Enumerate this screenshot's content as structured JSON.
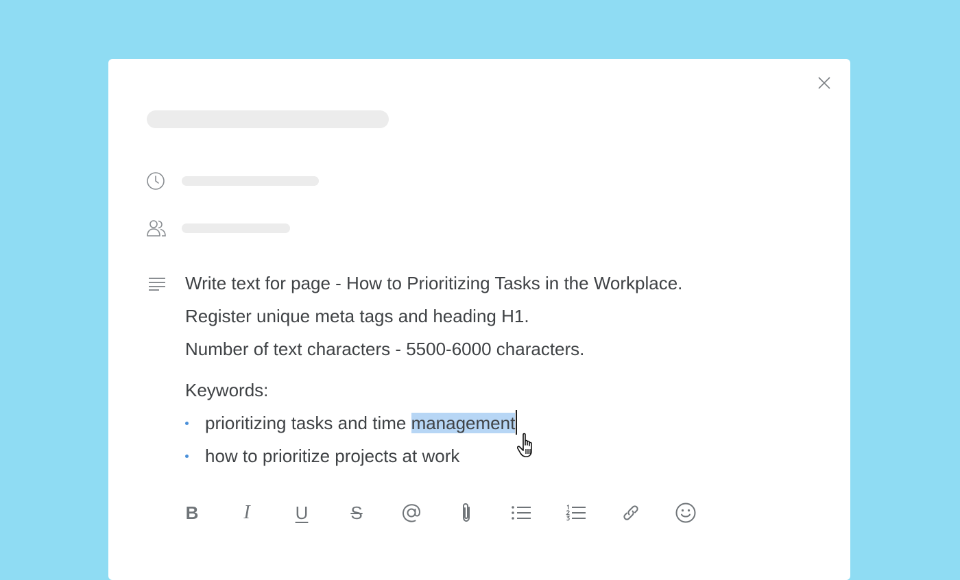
{
  "description": {
    "lines": [
      "Write text for page - How to Prioritizing Tasks in the Workplace.",
      "Register unique meta tags and heading H1.",
      "Number of text characters - 5500-6000 characters."
    ],
    "keywords_label": "Keywords:",
    "keywords": [
      {
        "before": "prioritizing tasks and time ",
        "selected": "management"
      },
      {
        "before": "how to prioritize projects at work",
        "selected": ""
      }
    ]
  },
  "toolbar": {
    "bold": "B",
    "italic": "I",
    "underline": "U",
    "strikethrough": "S"
  },
  "colors": {
    "background": "#8fdcf3",
    "selection": "#b7d6f5",
    "bullet": "#4a90d9"
  }
}
